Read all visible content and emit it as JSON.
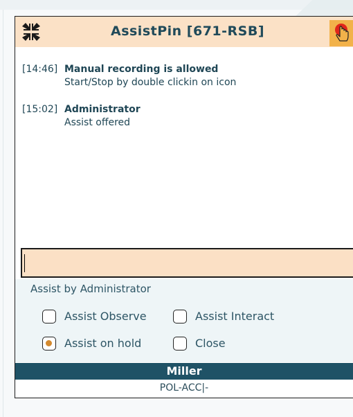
{
  "window": {
    "title": "AssistPin [671-RSB]",
    "minimize_icon": "collapse-arrows-icon",
    "record_icon": "record-hand-icon"
  },
  "log": [
    {
      "time": "[14:46]",
      "who": "Manual recording is allowed",
      "detail": "Start/Stop by double clickin on icon"
    },
    {
      "time": "[15:02]",
      "who": "Administrator",
      "detail": "Assist offered"
    }
  ],
  "message_input": {
    "value": ""
  },
  "assist_panel": {
    "title": "Assist by Administrator",
    "options": [
      {
        "label": "Assist Observe",
        "checked": false
      },
      {
        "label": "Assist Interact",
        "checked": false
      },
      {
        "label": "Assist on hold",
        "checked": true
      },
      {
        "label": "Close",
        "checked": false
      }
    ]
  },
  "user": {
    "name": "Miller",
    "status": "POL-ACC|-"
  },
  "colors": {
    "title_bg": "#fbe1c6",
    "title_text": "#204a5a",
    "record_button": "#f2b24a",
    "record_dot": "#e0261b",
    "user_band": "#1f5266",
    "selected_dot": "#d48a2f"
  }
}
